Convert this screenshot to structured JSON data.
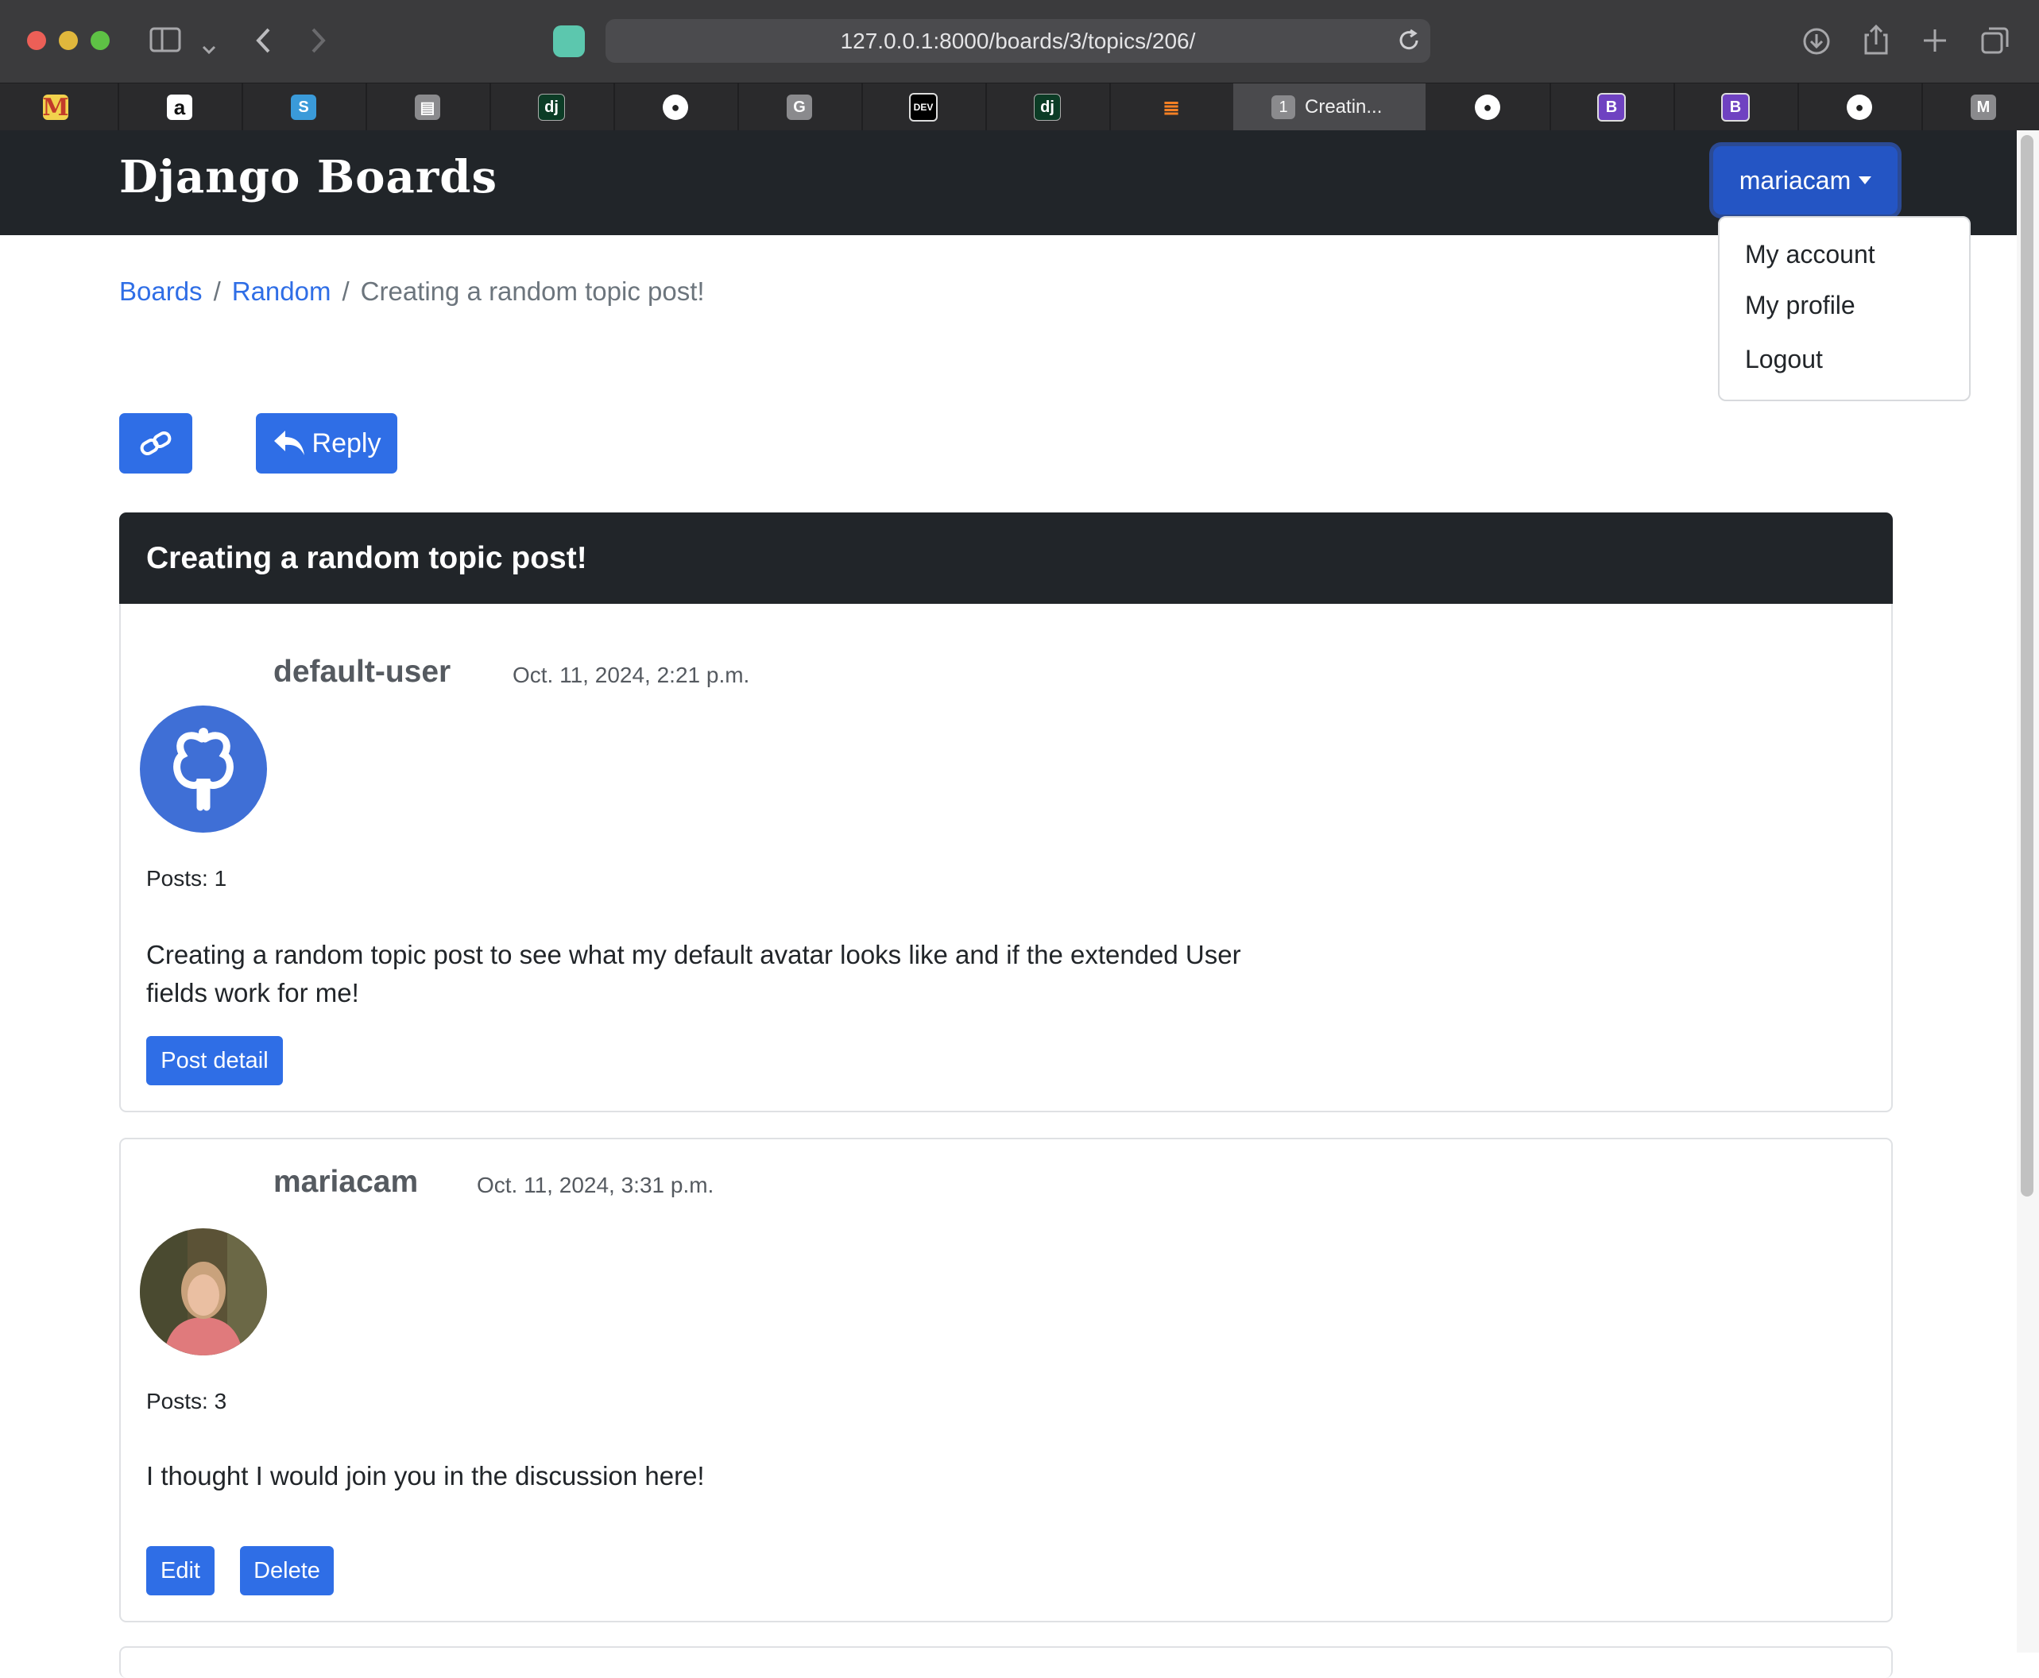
{
  "browser": {
    "url": "127.0.0.1:8000/boards/3/topics/206/",
    "active_tab_label": "Creatin...",
    "active_tab_badge": "1",
    "favicons": [
      "gmail-icon",
      "amazon-icon",
      "s-icon",
      "reader-icon",
      "django-icon",
      "github-icon",
      "google-icon",
      "dev-icon",
      "django-icon",
      "stackoverflow-icon",
      "github-icon",
      "bootstrap-icon",
      "bootstrap-icon",
      "github-icon",
      "m-icon"
    ]
  },
  "navbar": {
    "brand": "Django Boards",
    "user": "mariacam",
    "menu": [
      "My account",
      "My profile",
      "Logout"
    ]
  },
  "breadcrumb": {
    "boards": "Boards",
    "board": "Random",
    "current": "Creating a random topic post!"
  },
  "actions": {
    "reply": "Reply"
  },
  "topic": {
    "title": "Creating a random topic post!"
  },
  "posts": [
    {
      "author": "default-user",
      "date": "Oct. 11, 2024, 2:21 p.m.",
      "posts_count": "Posts: 1",
      "message": "Creating a random topic post to see what my default avatar looks like and if the extended User fields work for me!",
      "button": "Post detail"
    },
    {
      "author": "mariacam",
      "date": "Oct. 11, 2024, 3:31 p.m.",
      "posts_count": "Posts: 3",
      "message": "I thought I would join you in the discussion here!",
      "edit": "Edit",
      "delete": "Delete"
    }
  ],
  "colors": {
    "primary": "#2f6ee6",
    "navbar": "#212529",
    "avatar_blue": "#3f6fd6"
  }
}
